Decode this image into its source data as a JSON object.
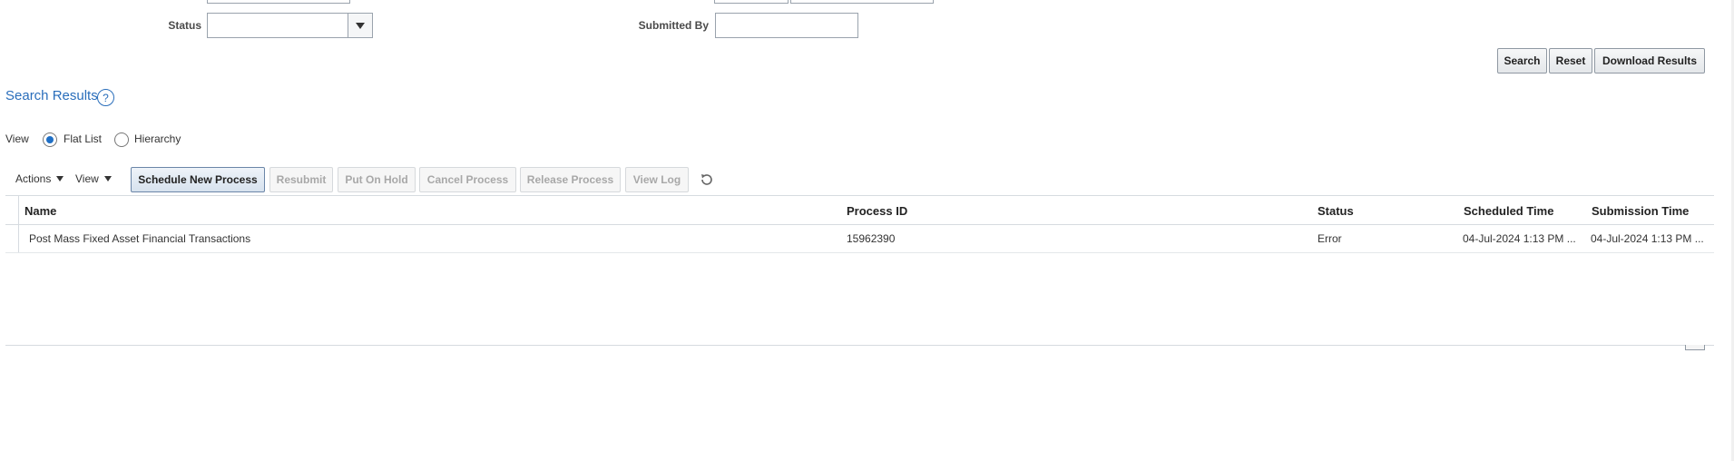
{
  "filters": {
    "status_label": "Status",
    "status_value": "",
    "submitted_by_label": "Submitted By",
    "submitted_by_value": ""
  },
  "search_buttons": {
    "search": "Search",
    "reset": "Reset",
    "download": "Download Results"
  },
  "results": {
    "title": "Search Results",
    "help_glyph": "?",
    "view_label": "View",
    "view_options": [
      {
        "label": "Flat List",
        "selected": true
      },
      {
        "label": "Hierarchy",
        "selected": false
      }
    ]
  },
  "toolbar": {
    "actions": "Actions",
    "view": "View",
    "schedule_new_process": "Schedule New Process",
    "resubmit": "Resubmit",
    "put_on_hold": "Put On Hold",
    "cancel_process": "Cancel Process",
    "release_process": "Release Process",
    "view_log": "View Log"
  },
  "table": {
    "columns": [
      "Name",
      "Process ID",
      "Status",
      "Scheduled Time",
      "Submission Time"
    ],
    "rows": [
      {
        "name": "Post Mass Fixed Asset Financial Transactions",
        "process_id": "15962390",
        "status": "Error",
        "scheduled_time": "04-Jul-2024 1:13 PM ...",
        "submission_time": "04-Jul-2024 1:13 PM ..."
      }
    ]
  },
  "colors": {
    "link_blue": "#2a6ebb",
    "radio_selected": "#1f6fc5"
  },
  "icons": {
    "dropdown": "chevron-down-icon",
    "help": "help-icon",
    "refresh": "refresh-icon"
  }
}
